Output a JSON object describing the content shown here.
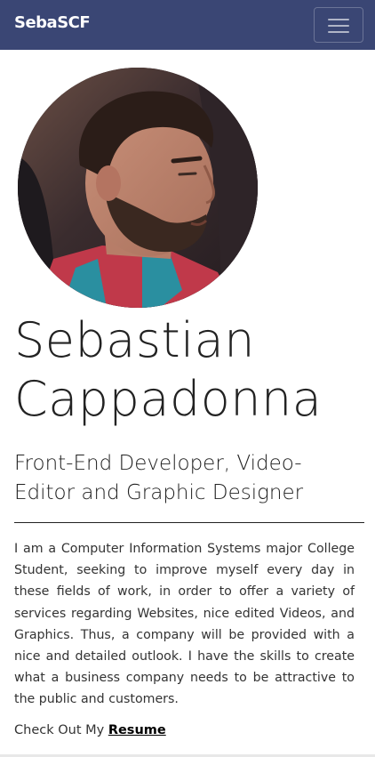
{
  "navbar": {
    "brand": "SebaSCF",
    "toggle_icon": "hamburger-menu-icon",
    "background_color": "#3a4674"
  },
  "profile": {
    "photo_icon": "profile-photo",
    "name_line1": "Sebastian",
    "name_line2": "Cappadonna",
    "tagline_line1": "Front-End Developer, Video-",
    "tagline_line2": "Editor and Graphic Designer",
    "bio": "I am a Computer Information Systems major College Student, seeking to improve myself every day in these fields of work, in order to offer a variety of services regarding Websites, nice edited Videos, and Graphics. Thus, a company will be provided with a nice and detailed outlook. I have the skills to create what a business company needs to be attractive to the public and customers.",
    "resume_prefix": "Check Out My",
    "resume_link": "Resume"
  }
}
